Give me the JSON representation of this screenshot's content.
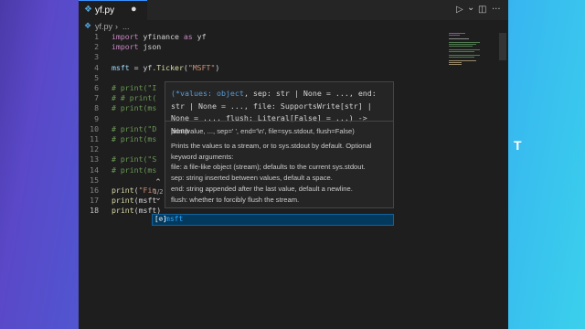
{
  "tab": {
    "icon": "python-file-icon",
    "filename": "yf.py",
    "dirty_indicator": "●"
  },
  "toolbar": {
    "run": "▷",
    "run_chevron": "⌄",
    "split": "◫",
    "more": "···"
  },
  "breadcrumb": {
    "file": "yf.py",
    "separator": "›",
    "symbol": "..."
  },
  "code": {
    "active_line": 18,
    "lines": [
      {
        "n": "1",
        "segs": [
          {
            "t": "import",
            "c": "kw"
          },
          {
            "t": " yfinance ",
            "c": ""
          },
          {
            "t": "as",
            "c": "kw"
          },
          {
            "t": " yf",
            "c": ""
          }
        ]
      },
      {
        "n": "2",
        "segs": [
          {
            "t": "import",
            "c": "kw"
          },
          {
            "t": " json",
            "c": ""
          }
        ]
      },
      {
        "n": "3",
        "segs": []
      },
      {
        "n": "4",
        "segs": [
          {
            "t": "msft",
            "c": "var"
          },
          {
            "t": " = yf.",
            "c": ""
          },
          {
            "t": "Ticker",
            "c": "fn"
          },
          {
            "t": "(",
            "c": ""
          },
          {
            "t": "\"MSFT\"",
            "c": "str"
          },
          {
            "t": ")",
            "c": ""
          }
        ]
      },
      {
        "n": "5",
        "segs": []
      },
      {
        "n": "6",
        "segs": [
          {
            "t": "# print(\"I",
            "c": "cm"
          }
        ]
      },
      {
        "n": "7",
        "segs": [
          {
            "t": "# # print(",
            "c": "cm"
          }
        ]
      },
      {
        "n": "8",
        "segs": [
          {
            "t": "# print(ms",
            "c": "cm"
          }
        ]
      },
      {
        "n": "9",
        "segs": []
      },
      {
        "n": "10",
        "segs": [
          {
            "t": "# print(\"D",
            "c": "cm"
          }
        ]
      },
      {
        "n": "11",
        "segs": [
          {
            "t": "# print(ms",
            "c": "cm"
          }
        ]
      },
      {
        "n": "12",
        "segs": []
      },
      {
        "n": "13",
        "segs": [
          {
            "t": "# print(\"S",
            "c": "cm"
          }
        ]
      },
      {
        "n": "14",
        "segs": [
          {
            "t": "# print(ms",
            "c": "cm"
          }
        ]
      },
      {
        "n": "15",
        "segs": []
      },
      {
        "n": "16",
        "segs": [
          {
            "t": "print",
            "c": "fn"
          },
          {
            "t": "(",
            "c": ""
          },
          {
            "t": "\"Fin",
            "c": "str"
          }
        ]
      },
      {
        "n": "17",
        "segs": [
          {
            "t": "print",
            "c": "fn"
          },
          {
            "t": "(msft",
            "c": ""
          }
        ]
      },
      {
        "n": "18",
        "segs": [
          {
            "t": "print",
            "c": "fn"
          },
          {
            "t": "(msft)",
            "c": ""
          }
        ]
      }
    ]
  },
  "hover": {
    "signature_param": "(*values: object",
    "signature_rest": ", sep: str | None = ..., end: str | None = ..., file: SupportsWrite[str] | None = ..., flush: Literal[False] = ...) -> None",
    "doc_lines": [
      "print(value, ..., sep=' ', end='\\n', file=sys.stdout, flush=False)",
      "",
      "Prints the values to a stream, or to sys.stdout by default. Optional keyword arguments:",
      "file: a file-like object (stream); defaults to the current sys.stdout.",
      "sep: string inserted between values, default a space.",
      "end: string appended after the last value, default a newline.",
      "flush: whether to forcibly flush the stream."
    ],
    "overload_up": "⌃",
    "overload_counter": "1/2",
    "overload_down": "⌄"
  },
  "suggest": {
    "icon": "[⊘]",
    "item": "msft"
  },
  "background_fragment": "T",
  "colors": {
    "accent": "#3794ff",
    "editor_bg": "#1e1e1e",
    "suggest_highlight": "#04395e"
  }
}
